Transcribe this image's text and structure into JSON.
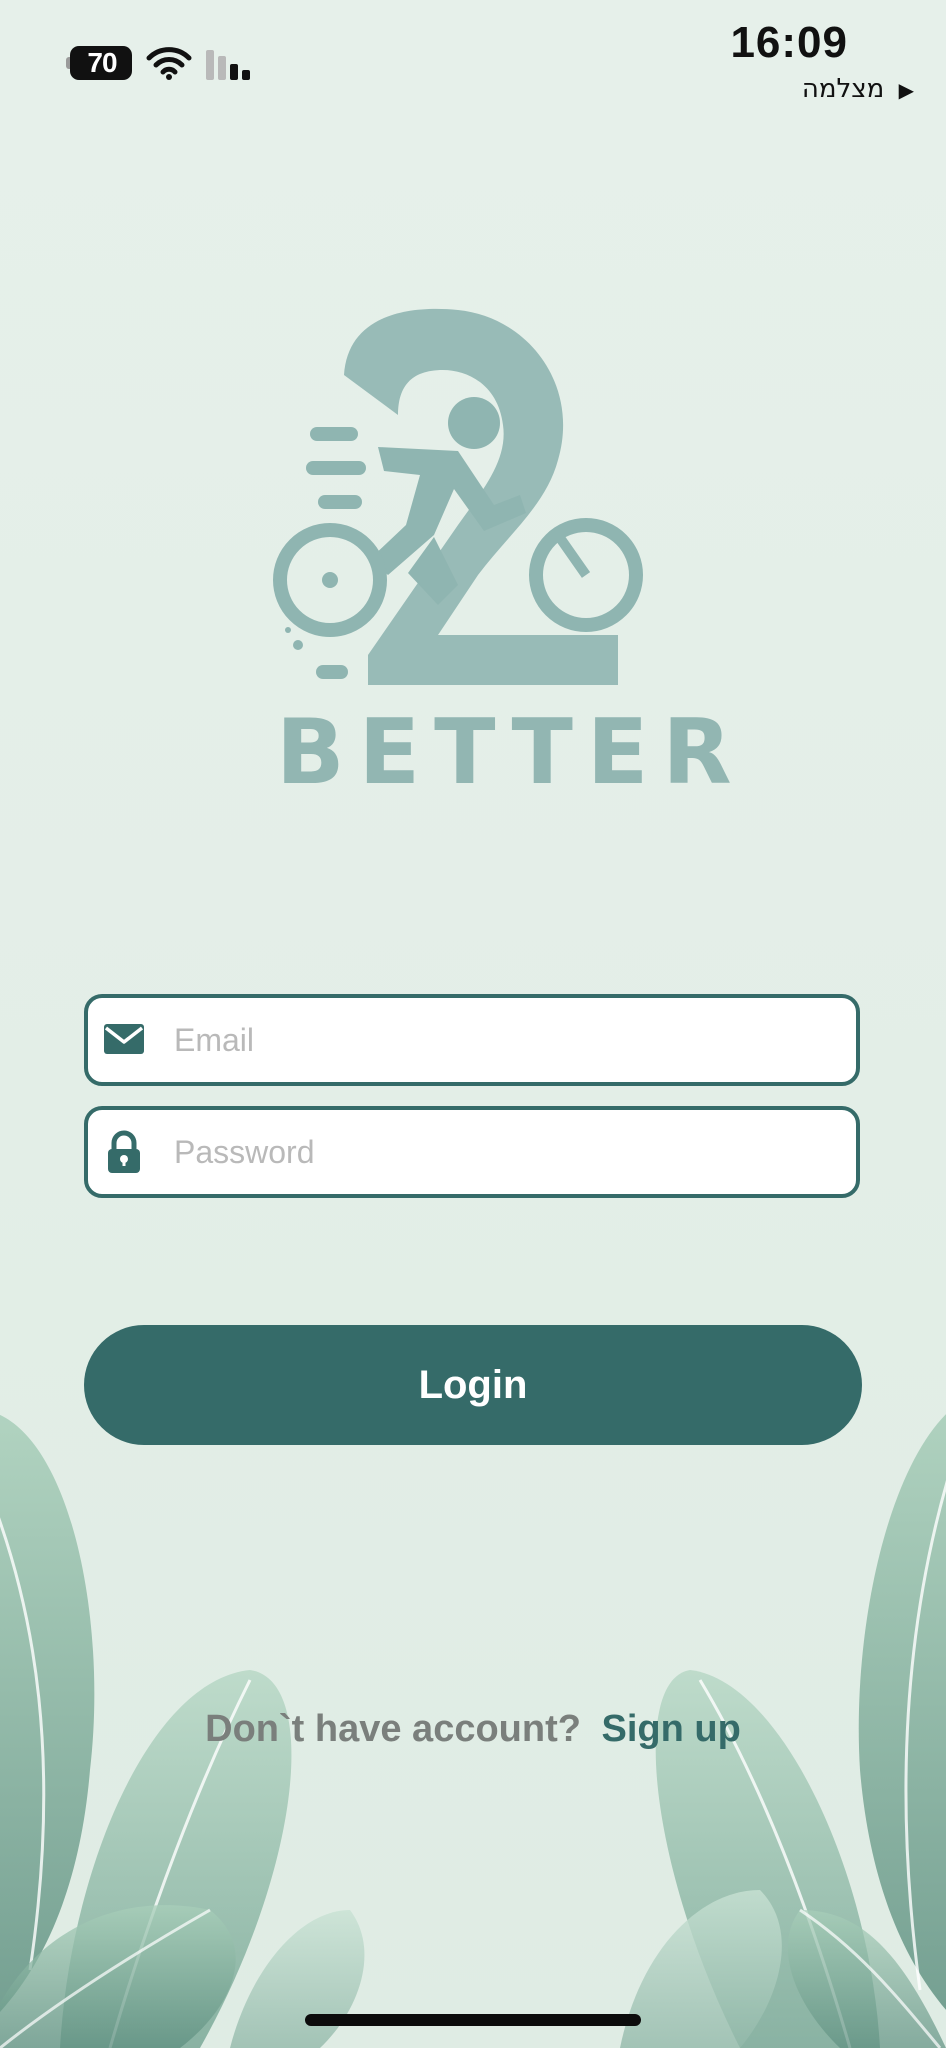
{
  "status_bar": {
    "battery_level": "70",
    "time": "16:09",
    "back_app_label": "מצלמה",
    "back_arrow": "▶"
  },
  "logo": {
    "word": "BETTER",
    "icon_name": "cyclist-number-2-logo"
  },
  "form": {
    "email": {
      "placeholder": "Email",
      "value": "",
      "icon": "envelope-icon"
    },
    "password": {
      "placeholder": "Password",
      "value": "",
      "icon": "lock-icon"
    },
    "login_label": "Login"
  },
  "signup": {
    "question": "Don`t have account?",
    "link_label": "Sign up"
  },
  "colors": {
    "accent": "#356b69",
    "background": "#e4efe8",
    "logo": "#8eb3b0",
    "muted_text": "#7a7f7c"
  }
}
